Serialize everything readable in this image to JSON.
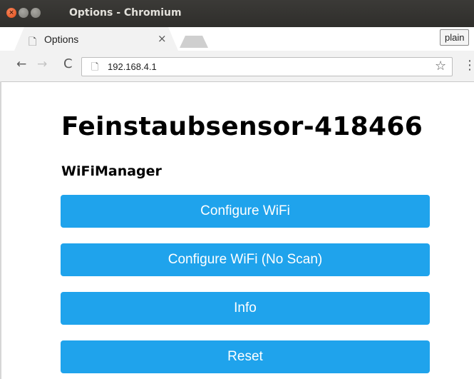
{
  "window": {
    "title": "Options - Chromium",
    "close_glyph": "×",
    "min_glyph": "–",
    "max_glyph": "▫"
  },
  "tab": {
    "title": "Options",
    "close_glyph": "×",
    "icon": "page-icon"
  },
  "profile": {
    "label": "plain"
  },
  "toolbar": {
    "back_glyph": "←",
    "forward_glyph": "→",
    "reload_glyph": "C",
    "url": "192.168.4.1",
    "page_glyph": "🗋",
    "star_glyph": "☆",
    "menu_glyph": "⋮"
  },
  "page": {
    "title": "Feinstaubsensor-418466",
    "section": "WiFiManager",
    "buttons": [
      {
        "label": "Configure WiFi"
      },
      {
        "label": "Configure WiFi (No Scan)"
      },
      {
        "label": "Info"
      },
      {
        "label": "Reset"
      }
    ],
    "button_color": "#1fa3ec"
  }
}
